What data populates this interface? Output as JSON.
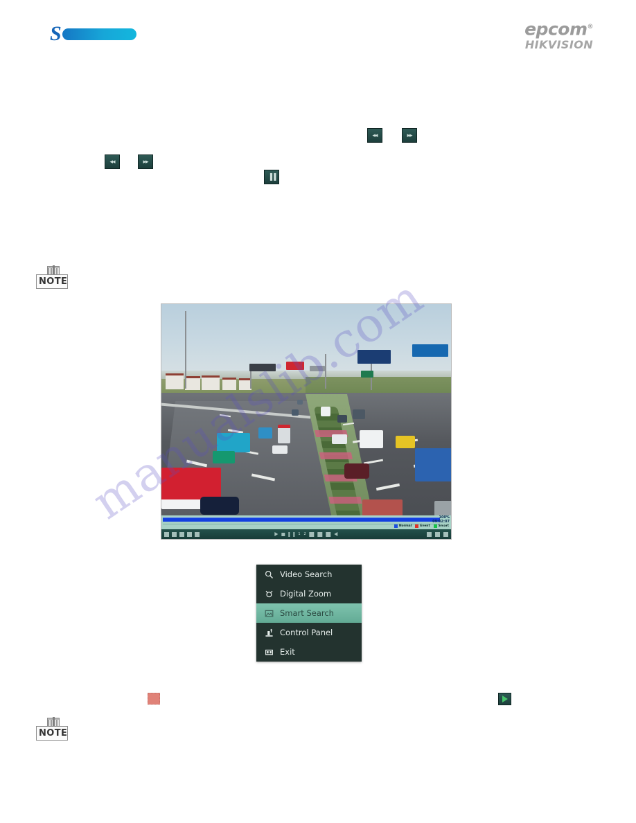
{
  "header": {
    "left_logo": {
      "letter": "S",
      "name": "brand-logo-left"
    },
    "right_logo": {
      "primary": "epcom",
      "trademark": "®",
      "secondary": "HIKVISION"
    }
  },
  "toolbar_icons": {
    "row1": [
      {
        "name": "rewind-button",
        "glyph": "◂◂",
        "label": "Speed Down"
      },
      {
        "name": "fast-forward-button",
        "glyph": "▸▸",
        "label": "Speed Up"
      }
    ],
    "row2": [
      {
        "name": "rewind-button",
        "glyph": "◂◂",
        "label": "Speed Down"
      },
      {
        "name": "fast-forward-button",
        "glyph": "▸▸",
        "label": "Speed Up"
      }
    ],
    "row3": [
      {
        "name": "pause-button",
        "glyph": "▐▐",
        "label": "Pause"
      }
    ]
  },
  "note_blocks": [
    {
      "name": "note-icon-top",
      "label": "NOTE"
    },
    {
      "name": "note-icon-bottom",
      "label": "NOTE"
    }
  ],
  "screenshot": {
    "name": "playback-screenshot",
    "timeline": {
      "progress_label": "100%",
      "time_label": "09:02:07",
      "legend": [
        {
          "label": "Normal",
          "color": "#1d4fe0"
        },
        {
          "label": "Event",
          "color": "#e03027"
        },
        {
          "label": "Smart",
          "color": "#17c24a"
        }
      ]
    },
    "control_bar": {
      "speed_numbers": [
        "1",
        "2"
      ]
    }
  },
  "context_menu": {
    "name": "playback-context-menu",
    "items": [
      {
        "label": "Video Search",
        "icon": "magnifier-icon",
        "selected": false
      },
      {
        "label": "Digital Zoom",
        "icon": "zoom-icon",
        "selected": false
      },
      {
        "label": "Smart Search",
        "icon": "picture-icon",
        "selected": true
      },
      {
        "label": "Control Panel",
        "icon": "control-panel-icon",
        "selected": false
      },
      {
        "label": "Exit",
        "icon": "exit-icon",
        "selected": false
      }
    ]
  },
  "inline_marks": {
    "red_swatch": {
      "name": "red-area-swatch",
      "color": "#e08278"
    },
    "play_button": {
      "name": "play-button",
      "glyph": "▶",
      "color": "#46c46a"
    }
  },
  "watermark": {
    "text": "manualslib.com"
  }
}
